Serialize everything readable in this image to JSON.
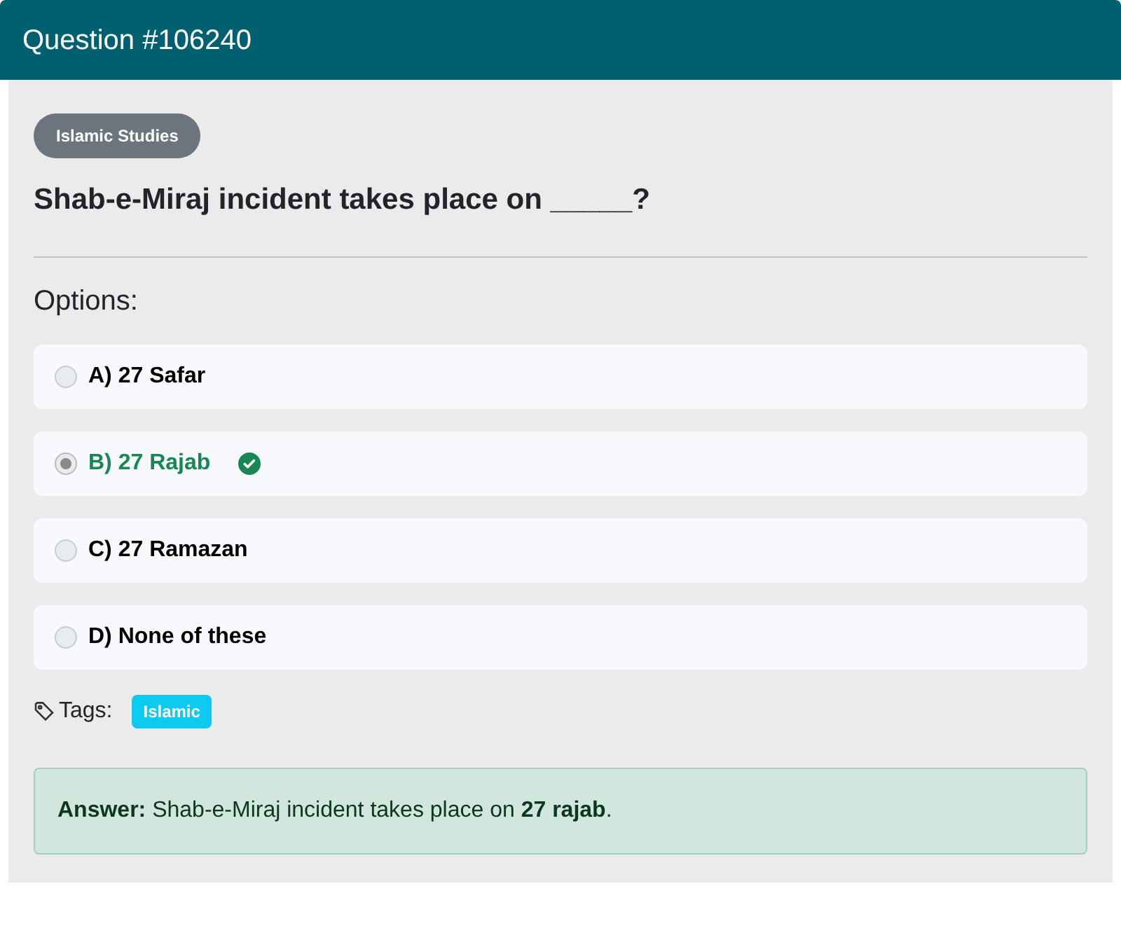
{
  "header": {
    "title": "Question #106240"
  },
  "category": "Islamic Studies",
  "question": "Shab-e-Miraj incident takes place on _____?",
  "options_heading": "Options:",
  "options": [
    {
      "label": "A) 27 Safar",
      "selected": false,
      "correct": false
    },
    {
      "label": "B) 27 Rajab",
      "selected": true,
      "correct": true
    },
    {
      "label": "C) 27 Ramazan",
      "selected": false,
      "correct": false
    },
    {
      "label": "D) None of these",
      "selected": false,
      "correct": false
    }
  ],
  "tags_label": "Tags:",
  "tags": [
    "Islamic"
  ],
  "answer": "**Answer:** Shab-e-Miraj incident takes place on **27 rajab**."
}
